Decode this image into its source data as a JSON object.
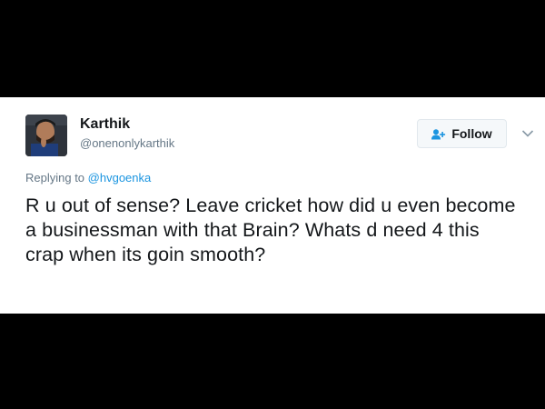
{
  "tweet": {
    "display_name": "Karthik",
    "handle": "@onenonlykarthik",
    "follow_label": "Follow",
    "replying_prefix": "Replying to ",
    "replying_to": "@hvgoenka",
    "text": "R u out of sense? Leave cricket how did u even become a businessman with that Brain? Whats d need 4 this crap when its goin smooth?"
  },
  "icons": {
    "avatar": "avatar",
    "follow": "add-user-icon",
    "caret": "chevron-down-icon"
  },
  "colors": {
    "link": "#1b95e0",
    "secondary_text": "#657786",
    "primary_text": "#14171a"
  }
}
